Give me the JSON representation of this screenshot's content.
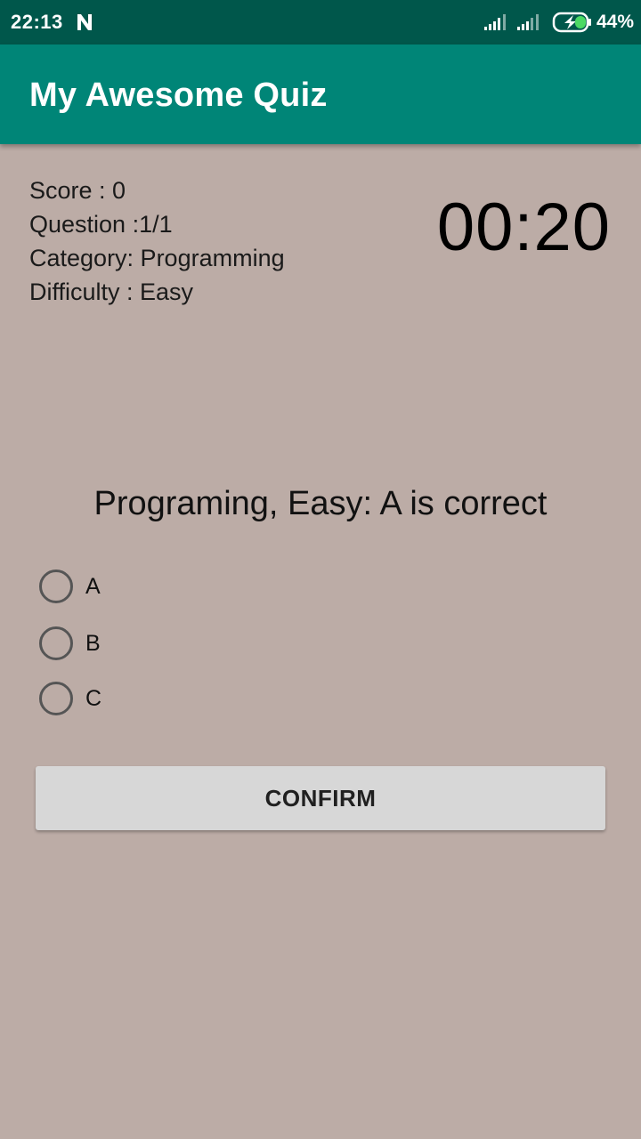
{
  "status_bar": {
    "time": "22:13",
    "notification_icon": "n-notification-icon",
    "signal_icons": [
      "signal-icon",
      "signal-icon"
    ],
    "battery_icon": "battery-charging-icon",
    "battery_level": "44%"
  },
  "app_bar": {
    "title": "My Awesome Quiz"
  },
  "info": {
    "score": "Score : 0",
    "question": "Question :1/1",
    "category": "Category: Programming",
    "difficulty": "Difficulty : Easy"
  },
  "timer": "00:20",
  "question": {
    "text": "Programing, Easy: A is correct",
    "options": [
      "A",
      "B",
      "C"
    ],
    "selected": null
  },
  "confirm_label": "CONFIRM",
  "colors": {
    "status_bar": "#00574b",
    "app_bar": "#008577",
    "background": "#bcaca6",
    "button": "#d7d7d7"
  }
}
